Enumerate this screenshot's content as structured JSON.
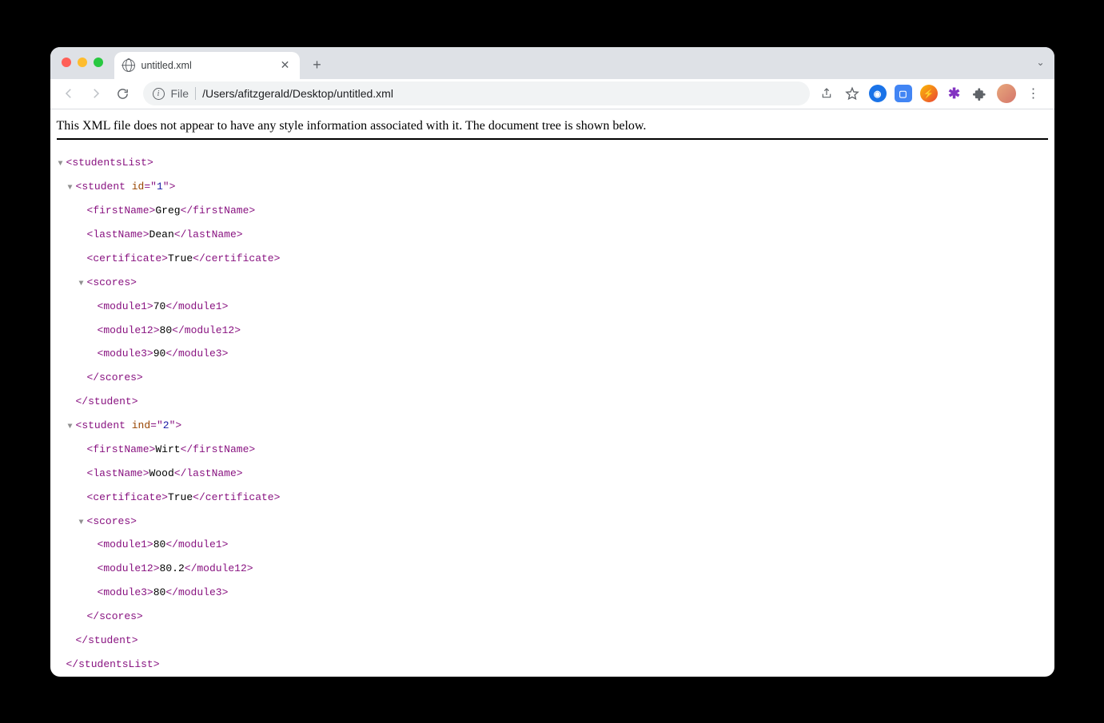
{
  "tab": {
    "title": "untitled.xml"
  },
  "address": {
    "scheme": "File",
    "path": "/Users/afitzgerald/Desktop/untitled.xml"
  },
  "notice": "This XML file does not appear to have any style information associated with it. The document tree is shown below.",
  "xml": {
    "root": "studentsList",
    "students": [
      {
        "attrName": "id",
        "attrVal": "1",
        "firstName": "Greg",
        "lastName": "Dean",
        "certificate": "True",
        "scores": {
          "module1": "70",
          "module12": "80",
          "module3": "90"
        }
      },
      {
        "attrName": "ind",
        "attrVal": "2",
        "firstName": "Wirt",
        "lastName": "Wood",
        "certificate": "True",
        "scores": {
          "module1": "80",
          "module12": "80.2",
          "module3": "80"
        }
      }
    ]
  },
  "tags": {
    "student": "student",
    "firstName": "firstName",
    "lastName": "lastName",
    "certificate": "certificate",
    "scores": "scores",
    "module1": "module1",
    "module12": "module12",
    "module3": "module3"
  }
}
